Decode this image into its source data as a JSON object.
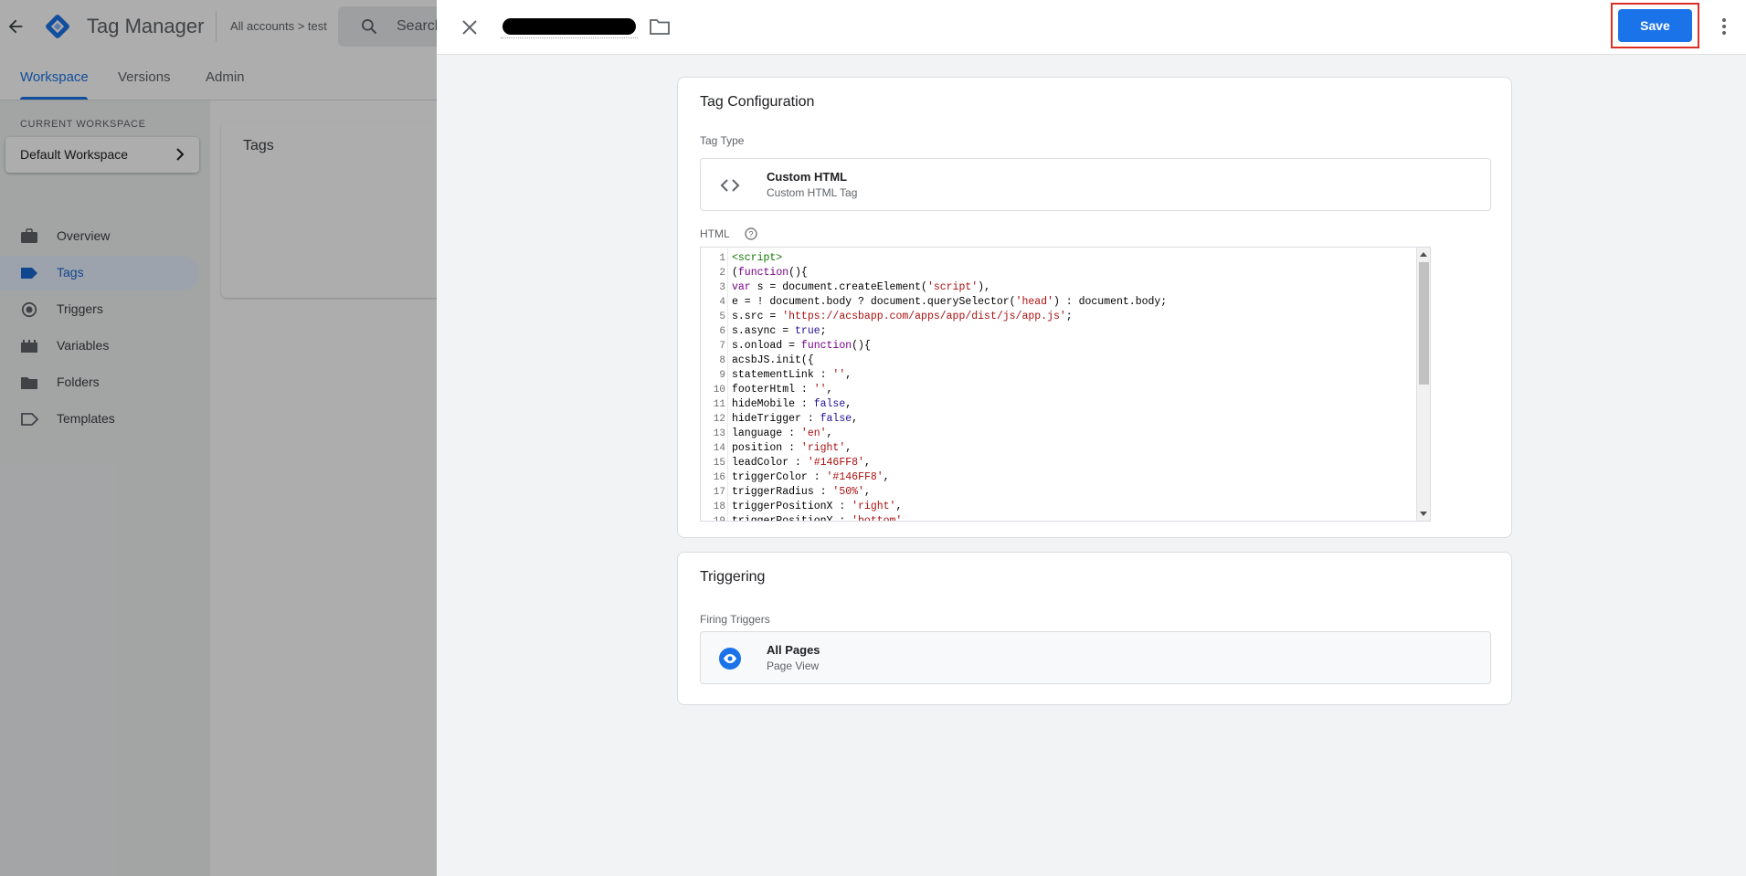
{
  "background": {
    "app_title": "Tag Manager",
    "account_crumb": "All accounts > test",
    "search_placeholder": "Search",
    "tabs": [
      "Workspace",
      "Versions",
      "Admin"
    ],
    "current_workspace_label": "CURRENT WORKSPACE",
    "workspace_name": "Default Workspace",
    "nav": [
      "Overview",
      "Tags",
      "Triggers",
      "Variables",
      "Folders",
      "Templates"
    ],
    "content_title": "Tags"
  },
  "editor": {
    "save_label": "Save",
    "tag_config": {
      "title": "Tag Configuration",
      "tag_type_label": "Tag Type",
      "type_name": "Custom HTML",
      "type_sub": "Custom HTML Tag",
      "html_label": "HTML"
    },
    "code_lines": [
      "<script>",
      "(function(){",
      "var s = document.createElement('script'),",
      "e = ! document.body ? document.querySelector('head') : document.body;",
      "s.src = 'https://acsbapp.com/apps/app/dist/js/app.js';",
      "s.async = true;",
      "s.onload = function(){",
      "acsbJS.init({",
      "statementLink : '',",
      "footerHtml : '',",
      "hideMobile : false,",
      "hideTrigger : false,",
      "language : 'en',",
      "position : 'right',",
      "leadColor : '#146FF8',",
      "triggerColor : '#146FF8',",
      "triggerRadius : '50%',",
      "triggerPositionX : 'right',",
      "triggerPositionY : 'bottom',"
    ],
    "triggering": {
      "title": "Triggering",
      "firing_label": "Firing Triggers",
      "trigger_name": "All Pages",
      "trigger_sub": "Page View"
    }
  },
  "colors": {
    "primary": "#1a73e8",
    "highlight_outline": "#d93025"
  }
}
